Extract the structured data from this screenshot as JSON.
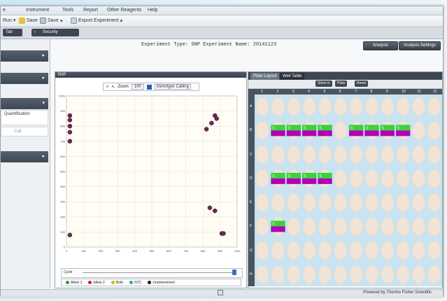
{
  "menubar": {
    "items": [
      "e",
      "Instrument",
      "Tools",
      "Report",
      "Other Reagents",
      "Help"
    ]
  },
  "toolbar": {
    "items": [
      "Run",
      "Save",
      "Save",
      "Export Experiment"
    ]
  },
  "tabrow": {
    "tabs": [
      "Tab",
      "Security"
    ]
  },
  "sidebar": {
    "sections": [
      {
        "label": ""
      },
      {
        "label": ""
      },
      {
        "label": ""
      },
      {
        "label": ""
      }
    ],
    "rows": [
      "Quantification",
      "Call"
    ]
  },
  "header": {
    "title": "Experiment Type: SNP   Experiment Name: 20141123",
    "buttons": [
      "Analysis",
      "Analysis Settings"
    ]
  },
  "plot": {
    "panel_title": "SNP",
    "toolbar_label": "Zoom",
    "toolbar_value": "100",
    "toolbar_select": "Genotype Calling",
    "slider_label": "Cycle",
    "legend": [
      {
        "label": "Allele 1",
        "color": "#2f9b2f"
      },
      {
        "label": "Allele 2",
        "color": "#cc2222"
      },
      {
        "label": "Both",
        "color": "#e0b000"
      },
      {
        "label": "NTC",
        "color": "#33aaaa"
      },
      {
        "label": "Undetermined",
        "color": "#111111"
      }
    ]
  },
  "chart_data": {
    "type": "scatter",
    "xlim": [
      0,
      1000
    ],
    "ylim": [
      0,
      1000
    ],
    "grid": true,
    "xticks": [
      0,
      100,
      200,
      300,
      400,
      500,
      600,
      700,
      800,
      900,
      1000
    ],
    "yticks": [
      0,
      100,
      200,
      300,
      400,
      500,
      600,
      700,
      800,
      900,
      1000
    ],
    "series": [
      {
        "color": "#6b2a55",
        "points": [
          [
            20,
            870
          ],
          [
            20,
            840
          ],
          [
            20,
            800
          ],
          [
            20,
            760
          ],
          [
            20,
            700
          ],
          [
            870,
            870
          ],
          [
            880,
            850
          ],
          [
            850,
            820
          ],
          [
            820,
            780
          ],
          [
            840,
            260
          ],
          [
            870,
            240
          ],
          [
            910,
            90
          ],
          [
            920,
            90
          ],
          [
            20,
            80
          ]
        ]
      }
    ]
  },
  "plate": {
    "tabs": [
      "Plate Layout",
      "Well Table"
    ],
    "sub_buttons": [
      "Show in",
      "Plate",
      "Reset"
    ],
    "columns": [
      "1",
      "2",
      "3",
      "4",
      "5",
      "6",
      "7",
      "8",
      "9",
      "10",
      "11",
      "12"
    ],
    "rows": [
      "A",
      "B",
      "C",
      "D",
      "E",
      "F",
      "G",
      "H"
    ],
    "well_tags": [
      "S",
      "S",
      "S",
      "S",
      "S",
      "S",
      "S",
      "S",
      "S",
      "S",
      "S",
      "S",
      "S"
    ]
  },
  "status": {
    "text": "Powered by Thermo Fisher Scientific"
  },
  "colors": {
    "accent_dark": "#3f4852",
    "well_fill": "#f1e4d7",
    "plate_bg": "#c9e3f0",
    "tag_green": "#3bd13b",
    "tag_magenta": "#b000b8",
    "point": "#6b2a55"
  }
}
